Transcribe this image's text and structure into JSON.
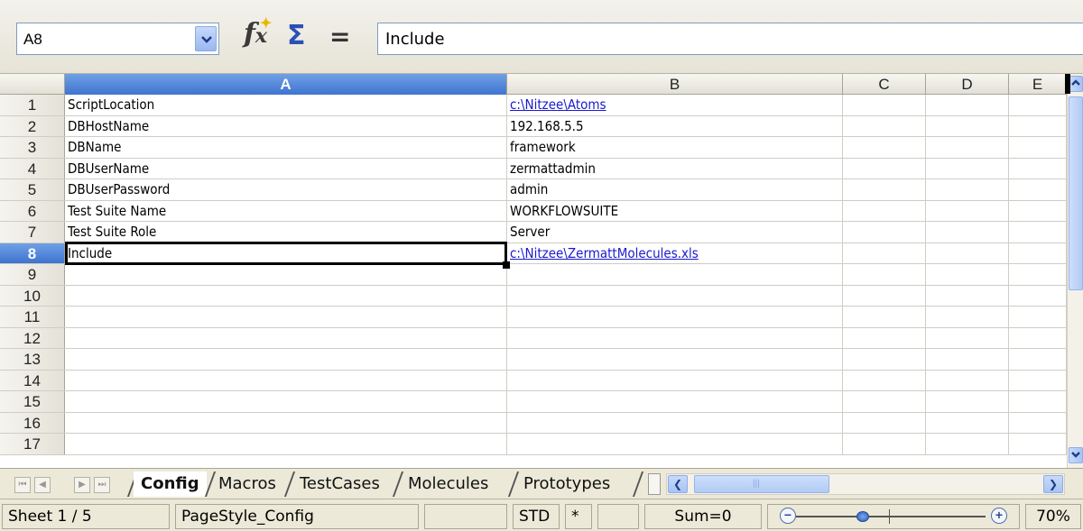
{
  "formula_bar": {
    "name_box": "A8",
    "formula": "Include"
  },
  "columns": [
    "A",
    "B",
    "C",
    "D",
    "E"
  ],
  "rows": [
    {
      "num": "1",
      "a": "ScriptLocation",
      "b": "c:\\Nitzee\\Atoms",
      "b_link": true
    },
    {
      "num": "2",
      "a": "DBHostName",
      "b": "192.168.5.5",
      "b_link": false
    },
    {
      "num": "3",
      "a": "DBName",
      "b": "framework",
      "b_link": false
    },
    {
      "num": "4",
      "a": "DBUserName",
      "b": "zermattadmin",
      "b_link": false
    },
    {
      "num": "5",
      "a": "DBUserPassword",
      "b": "admin",
      "b_link": false
    },
    {
      "num": "6",
      "a": "Test Suite Name",
      "b": "WORKFLOWSUITE",
      "b_link": false
    },
    {
      "num": "7",
      "a": "Test Suite Role",
      "b": "Server",
      "b_link": false
    },
    {
      "num": "8",
      "a": "Include",
      "b": "c:\\Nitzee\\ZermattMolecules.xls",
      "b_link": true
    },
    {
      "num": "9",
      "a": "",
      "b": "",
      "b_link": false
    },
    {
      "num": "10",
      "a": "",
      "b": "",
      "b_link": false
    },
    {
      "num": "11",
      "a": "",
      "b": "",
      "b_link": false
    },
    {
      "num": "12",
      "a": "",
      "b": "",
      "b_link": false
    },
    {
      "num": "13",
      "a": "",
      "b": "",
      "b_link": false
    },
    {
      "num": "14",
      "a": "",
      "b": "",
      "b_link": false
    },
    {
      "num": "15",
      "a": "",
      "b": "",
      "b_link": false
    },
    {
      "num": "16",
      "a": "",
      "b": "",
      "b_link": false
    },
    {
      "num": "17",
      "a": "",
      "b": "",
      "b_link": false
    }
  ],
  "active_cell": {
    "column": "A",
    "row": "8"
  },
  "sheet_tabs": [
    "Config",
    "Macros",
    "TestCases",
    "Molecules",
    "Prototypes"
  ],
  "active_tab": "Config",
  "status_bar": {
    "sheet": "Sheet 1 / 5",
    "page_style": "PageStyle_Config",
    "mode": "STD",
    "modified": "*",
    "sum": "Sum=0",
    "zoom": "70%",
    "zoom_level": 0.35
  },
  "colors": {
    "selection_header": "#3f74cf",
    "link": "#1a1ad2",
    "chrome": "#ece9d8"
  }
}
